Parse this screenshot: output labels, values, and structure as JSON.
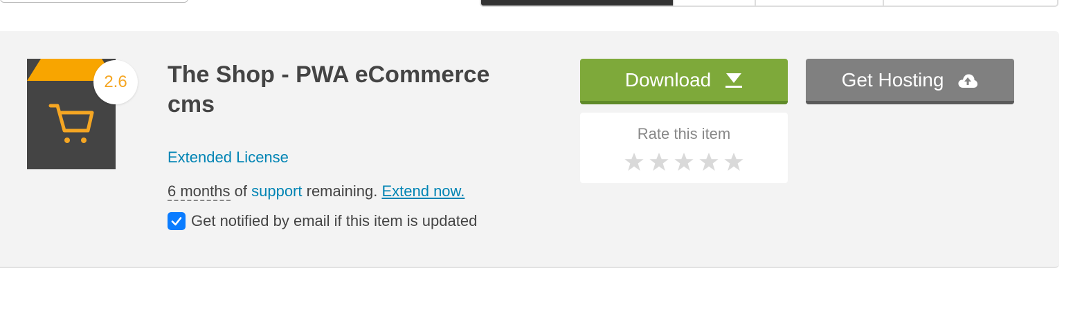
{
  "item": {
    "title": "The Shop - PWA eCommerce cms",
    "rating": "2.6",
    "license": "Extended License",
    "support": {
      "duration": "6 months",
      "of": "of",
      "support_link": "support",
      "remaining": "remaining.",
      "extend_link": "Extend now."
    },
    "notify": {
      "label": "Get notified by email if this item is updated",
      "checked": true
    },
    "thumbnail_colors": {
      "top": "#f8a500",
      "body": "#444444",
      "icon": "#f5a623"
    }
  },
  "actions": {
    "download_label": "Download",
    "hosting_label": "Get Hosting",
    "download_color": "#7ea93a",
    "hosting_color": "#808080"
  },
  "rating_widget": {
    "label": "Rate this item",
    "stars_filled": 0,
    "stars_total": 5
  },
  "icons": [
    "shopping-cart-icon",
    "download-arrow-icon",
    "cloud-upload-icon",
    "checkmark-icon",
    "star-icon"
  ]
}
